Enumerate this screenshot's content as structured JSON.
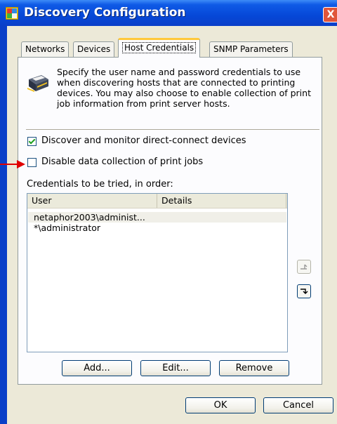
{
  "window": {
    "title": "Discovery Configuration",
    "close_label": "X"
  },
  "tabs": [
    {
      "label": "Networks",
      "active": false
    },
    {
      "label": "Devices",
      "active": false
    },
    {
      "label": "Host Credentials",
      "active": true
    },
    {
      "label": "SNMP Parameters",
      "active": false
    }
  ],
  "description": "Specify the user name and password credentials to use when discovering hosts that are connected to printing devices. You may also choose to enable collection of print job information from print server hosts.",
  "checkboxes": {
    "discover": {
      "label": "Discover and monitor direct-connect devices",
      "checked": true
    },
    "disable": {
      "label": "Disable data collection of print jobs",
      "checked": false
    }
  },
  "credentials": {
    "label": "Credentials to be tried, in order:",
    "columns": [
      "User",
      "Details"
    ],
    "rows": [
      {
        "user": "netaphor2003\\administ...",
        "details": ""
      },
      {
        "user": "*\\administrator",
        "details": ""
      }
    ]
  },
  "list_buttons": {
    "add": "Add...",
    "edit": "Edit...",
    "remove": "Remove"
  },
  "dialog_buttons": {
    "ok": "OK",
    "cancel": "Cancel"
  },
  "icons": {
    "title": "discovery-app-icon",
    "printer": "printer-icon",
    "move_up": "move-up-icon",
    "move_down": "move-down-icon",
    "annotation": "red-arrow-icon"
  },
  "colors": {
    "titlebar": "#0648d8",
    "dialog_bg": "#ece9d8",
    "active_tab_accent": "#ffc83c",
    "annotation_arrow": "#e00000"
  }
}
